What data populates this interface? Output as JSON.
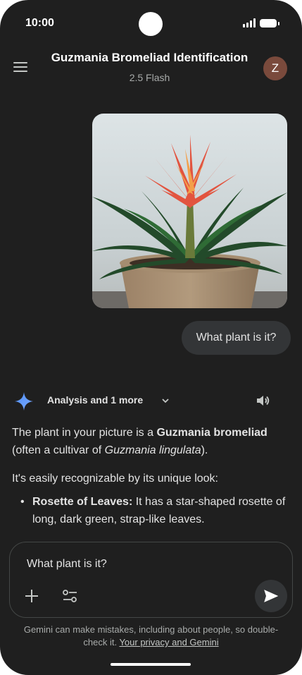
{
  "status": {
    "time": "10:00"
  },
  "header": {
    "title": "Guzmania Bromeliad Identification",
    "model": "2.5 Flash",
    "avatar_letter": "Z"
  },
  "user_message": {
    "text": "What plant is it?"
  },
  "assistant": {
    "chip_label": "Analysis and 1 more",
    "intro_before": "The plant in your picture is a ",
    "intro_bold": "Guzmania bromeliad",
    "intro_mid": " (often a cultivar of ",
    "intro_italic": "Guzmania lingulata",
    "intro_after": ").",
    "paragraph2": "It's easily recognizable by its unique look:",
    "bullets": [
      {
        "bold": "Rosette of Leaves:",
        "text": " It has a star-shaped rosette of long, dark green, strap-like leaves."
      }
    ]
  },
  "composer": {
    "value": "What plant is it?"
  },
  "disclaimer": {
    "text": "Gemini can make mistakes, including about people, so double-check it. ",
    "link": "Your privacy and Gemini"
  },
  "icons": [
    "menu-icon",
    "gemini-sparkle-icon",
    "chevron-down-icon",
    "speaker-icon",
    "plus-icon",
    "tools-icon",
    "send-icon"
  ]
}
